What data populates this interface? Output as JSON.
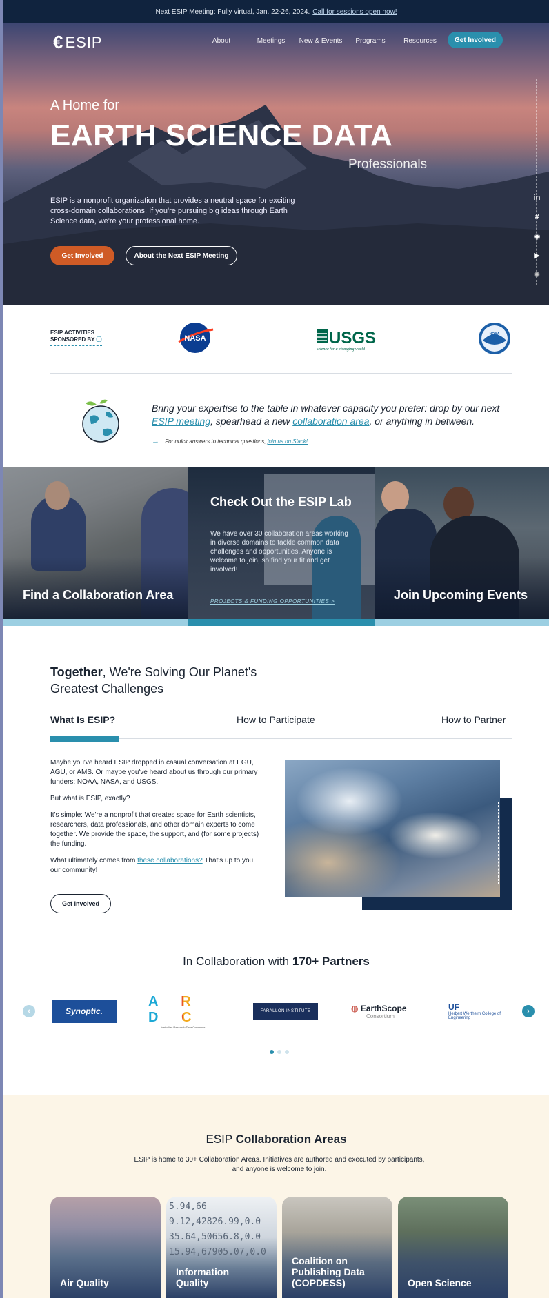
{
  "announcement": {
    "text": "Next ESIP Meeting: Fully virtual, Jan. 22-26, 2024.",
    "link": "Call for sessions open now!"
  },
  "nav": {
    "logo": "ESIP",
    "items": [
      "About",
      "Meetings",
      "New & Events",
      "Programs",
      "Resources"
    ],
    "cta": "Get Involved"
  },
  "hero": {
    "kicker": "A Home for",
    "title": "EARTH SCIENCE DATA",
    "subtitle": "Professionals",
    "body": "ESIP is a nonprofit organization that provides a neutral space for exciting cross-domain collaborations. If you're pursuing big ideas through Earth Science data, we're your professional home.",
    "primary_button": "Get Involved",
    "secondary_button": "About the Next ESIP Meeting"
  },
  "social_icons": [
    "linkedin-icon",
    "slack-icon",
    "github-icon",
    "youtube-icon",
    "settings-icon"
  ],
  "sponsors": {
    "label_line1": "ESIP ACTIVITIES",
    "label_line2": "SPONSORED BY",
    "logos": [
      "NASA",
      "USGS",
      "NOAA"
    ],
    "usgs_tagline": "science for a changing world"
  },
  "callout": {
    "text_before": "Bring your expertise to the table in whatever capacity you prefer: drop by our next",
    "link1": "ESIP meeting",
    "text_middle": ", spearhead a new",
    "link2": "collaboration area",
    "text_after": ", or anything in between.",
    "slack_text": "For quick answers to technical questions,",
    "slack_link": "join us on Slack!"
  },
  "panels": {
    "left_label": "Find a Collaboration Area",
    "center_title": "Check Out the ESIP Lab",
    "center_body": "We have over 30 collaboration areas working in diverse domains to tackle common data challenges and opportunities. Anyone is welcome to join, so find your fit and get involved!",
    "center_link": "PROJECTS & FUNDING OPPORTUNITIES >",
    "right_label": "Join Upcoming Events"
  },
  "together": {
    "bold": "Together",
    "rest_line1": ", We're Solving Our Planet's",
    "line2": "Greatest Challenges"
  },
  "tabs": [
    "What Is ESIP?",
    "How to Participate",
    "How to Partner"
  ],
  "what_is": {
    "p1": "Maybe you've heard ESIP dropped in casual conversation at EGU, AGU, or AMS. Or maybe you've heard about us through our primary funders: NOAA, NASA, and USGS.",
    "p2": "But what is ESIP, exactly?",
    "p3": "It's simple: We're a nonprofit that creates space for Earth scientists, researchers, data professionals, and other domain experts to come together. We provide the space, the support, and (for some projects) the funding.",
    "p4_before": "What ultimately comes from",
    "p4_link": "these collaborations?",
    "p4_after": "That's up to you, our community!",
    "button": "Get Involved"
  },
  "partners": {
    "title_before": "In Collaboration with",
    "title_bold": "170+ Partners",
    "logos": {
      "synoptic": "Synoptic.",
      "ardc": "A R D C",
      "ardc_sub": "Australian Research Data Commons",
      "farallon": "FARALLON INSTITUTE",
      "earthscope": "EarthScope",
      "earthscope_sub": "Consortium",
      "uf": "UF",
      "uf_sub": "Herbert Wertheim College of Engineering"
    }
  },
  "collab_areas": {
    "title_before": "ESIP",
    "title_bold": "Collaboration Areas",
    "desc": "ESIP is home to 30+ Collaboration Areas. Initiatives are authored and executed by participants, and anyone is welcome to join.",
    "cards": [
      "Air Quality",
      "Information Quality",
      "Coalition on Publishing Data (COPDESS)",
      "Open Science"
    ],
    "numbers_art": "5.94,66\n9.12,42826.99,0.0\n35.64,50656.8,0.0\n15.94,67905.07,0.0"
  }
}
